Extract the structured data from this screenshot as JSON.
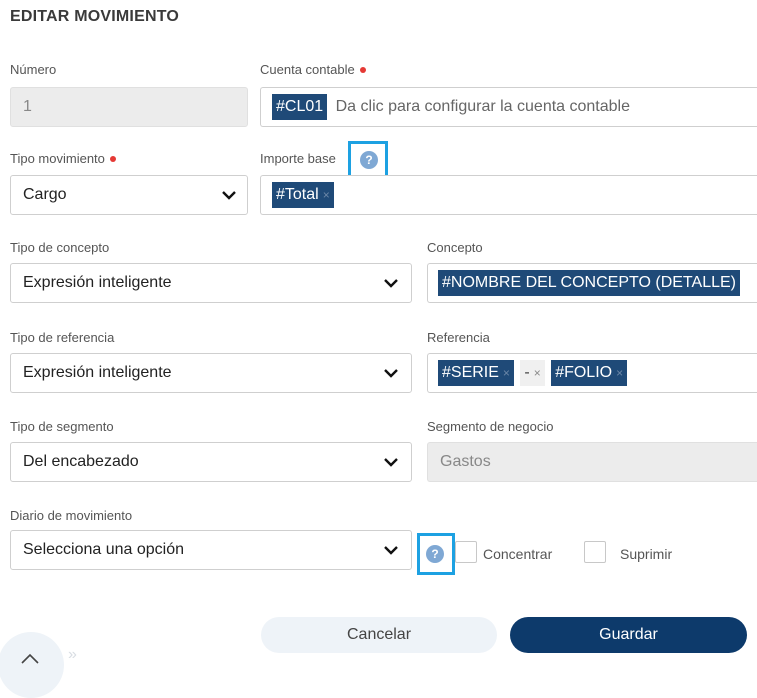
{
  "dialog": {
    "title": "EDITAR MOVIMIENTO"
  },
  "fields": {
    "numero": {
      "label": "Número",
      "value": "1"
    },
    "cuenta_contable": {
      "label": "Cuenta contable",
      "chip": "#CL01",
      "placeholder": "Da clic para configurar la cuenta contable"
    },
    "tipo_movimiento": {
      "label": "Tipo movimiento",
      "value": "Cargo"
    },
    "importe_base": {
      "label": "Importe base",
      "chips": [
        "#Total"
      ]
    },
    "tipo_concepto": {
      "label": "Tipo de concepto",
      "value": "Expresión inteligente"
    },
    "concepto": {
      "label": "Concepto",
      "chip": "#NOMBRE DEL CONCEPTO (DETALLE)"
    },
    "tipo_referencia": {
      "label": "Tipo de referencia",
      "value": "Expresión inteligente"
    },
    "referencia": {
      "label": "Referencia",
      "chips": [
        "#SERIE",
        "-",
        "#FOLIO"
      ]
    },
    "tipo_segmento": {
      "label": "Tipo de segmento",
      "value": "Del encabezado"
    },
    "segmento_negocio": {
      "label": "Segmento de negocio",
      "value": "Gastos"
    },
    "diario_movimiento": {
      "label": "Diario de movimiento",
      "value": "Selecciona una opción"
    }
  },
  "checkboxes": {
    "concentrar": "Concentrar",
    "suprimir": "Suprimir"
  },
  "help": {
    "glyph": "?"
  },
  "remove_glyph": "×",
  "buttons": {
    "cancel": "Cancelar",
    "save": "Guardar"
  },
  "icons": {
    "chevron": "chevron-down-icon",
    "help": "help-icon",
    "scroll": "chevron-up-icon"
  },
  "colors": {
    "chip": "#1f4a78",
    "required": "#e53935",
    "highlight": "#1da1e2",
    "save": "#0d3a6b"
  }
}
